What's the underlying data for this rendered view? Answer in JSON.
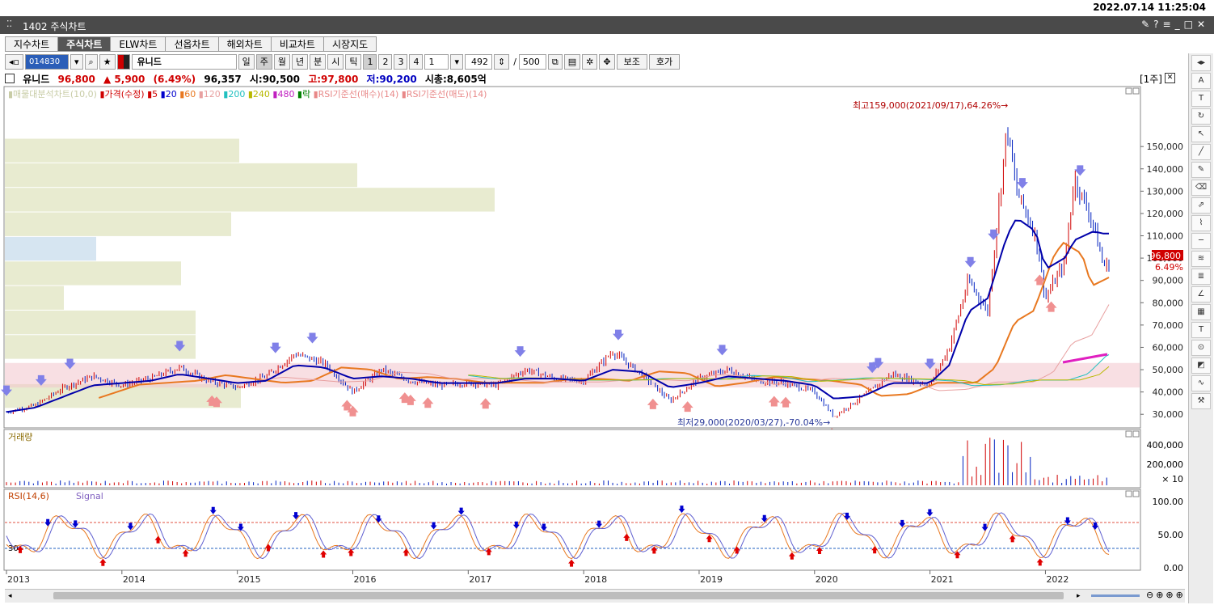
{
  "timestamp": "2022.07.14 11:25:04",
  "window": {
    "title": "1402 주식차트"
  },
  "tabs": [
    "지수차트",
    "주식차트",
    "ELW차트",
    "선옵차트",
    "해외차트",
    "비교차트",
    "시장지도"
  ],
  "toolbar": {
    "code": "014830",
    "name": "유니드",
    "periods": [
      "일",
      "주",
      "월",
      "년",
      "분",
      "시",
      "틱"
    ],
    "nums": [
      "1",
      "2",
      "3",
      "4"
    ],
    "unit_value": "1",
    "count": "492",
    "max": "500",
    "btn_aux": "보조",
    "btn_quote": "호가"
  },
  "info": {
    "name": "유니드",
    "price": "96,800",
    "change": "▲ 5,900",
    "pct": "(6.49%)",
    "avg": "96,357",
    "open": "시:90,500",
    "high": "고:97,800",
    "low": "저:90,200",
    "mcap": "시총:8,605억",
    "period_tag": "[1주]"
  },
  "price_panel": {
    "legend": [
      "매물대분석차트(10,0)",
      "가격(수정)",
      "5",
      "20",
      "60",
      "120",
      "200",
      "240",
      "480",
      "락",
      "RSI기준선(매수)(14)",
      "RSI기준선(매도)(14)"
    ],
    "legend_colors": [
      "#c8cca6",
      "#d00000",
      "#d00000",
      "#0000cc",
      "#e87820",
      "#e8a0a0",
      "#20c0c0",
      "#b8b800",
      "#c020c0",
      "#008000",
      "#e88888",
      "#e88888"
    ],
    "high_note": "최고159,000(2021/09/17),64.26%→",
    "low_note": "최저29,000(2020/03/27),-70.04%→",
    "current_price": "96,800",
    "current_pct": "6.49%"
  },
  "volume_panel": {
    "legend": "거래량",
    "y_labels": [
      "400,000",
      "200,000",
      "× 10"
    ]
  },
  "rsi_panel": {
    "legend1": "RSI(14,6)",
    "legend2": "Signal",
    "level_label": "30",
    "y_labels": [
      "100.00",
      "50.00",
      "0.00"
    ]
  },
  "x_labels": [
    "2013",
    "2014",
    "2015",
    "2016",
    "2017",
    "2018",
    "2019",
    "2020",
    "2021",
    "2022"
  ],
  "chart_data": {
    "type": "line",
    "title": "",
    "x": [
      "2013-01",
      "2013-04",
      "2013-07",
      "2013-10",
      "2014-01",
      "2014-04",
      "2014-07",
      "2014-10",
      "2015-01",
      "2015-04",
      "2015-07",
      "2015-10",
      "2016-01",
      "2016-04",
      "2016-07",
      "2016-10",
      "2017-01",
      "2017-04",
      "2017-07",
      "2017-10",
      "2018-01",
      "2018-04",
      "2018-07",
      "2018-10",
      "2019-01",
      "2019-04",
      "2019-07",
      "2019-10",
      "2020-01",
      "2020-03",
      "2020-06",
      "2020-09",
      "2021-01",
      "2021-03",
      "2021-05",
      "2021-07",
      "2021-09",
      "2021-10",
      "2021-12",
      "2022-01",
      "2022-03",
      "2022-04",
      "2022-06",
      "2022-07"
    ],
    "series": [
      {
        "name": "가격(수정)",
        "values": [
          31000,
          34000,
          42000,
          47000,
          43000,
          46000,
          51000,
          45000,
          42000,
          47000,
          57000,
          53000,
          40000,
          50000,
          45000,
          43000,
          44000,
          43000,
          50000,
          46000,
          45000,
          58000,
          48000,
          36000,
          46000,
          50000,
          45000,
          44000,
          40000,
          29000,
          38000,
          48000,
          43000,
          60000,
          90000,
          76000,
          159000,
          130000,
          110000,
          82000,
          98000,
          136000,
          115000,
          96800
        ]
      },
      {
        "name": "20",
        "values": [
          31000,
          33000,
          38000,
          43000,
          44000,
          45000,
          48000,
          46000,
          44000,
          45000,
          52000,
          51000,
          46000,
          47000,
          46000,
          44000,
          44000,
          44000,
          46000,
          46000,
          45000,
          50000,
          49000,
          42000,
          44000,
          47000,
          46000,
          45000,
          43000,
          37000,
          38000,
          44000,
          44000,
          52000,
          76000,
          82000,
          110000,
          118000,
          112000,
          95000,
          100000,
          108000,
          112000,
          111000
        ]
      }
    ],
    "ylim": [
      25000,
      170000
    ],
    "y_ticks": [
      "150,000",
      "140,000",
      "130,000",
      "120,000",
      "110,000",
      "100,000",
      "90,000",
      "80,000",
      "70,000",
      "60,000",
      "50,000",
      "40,000",
      "30,000"
    ]
  }
}
